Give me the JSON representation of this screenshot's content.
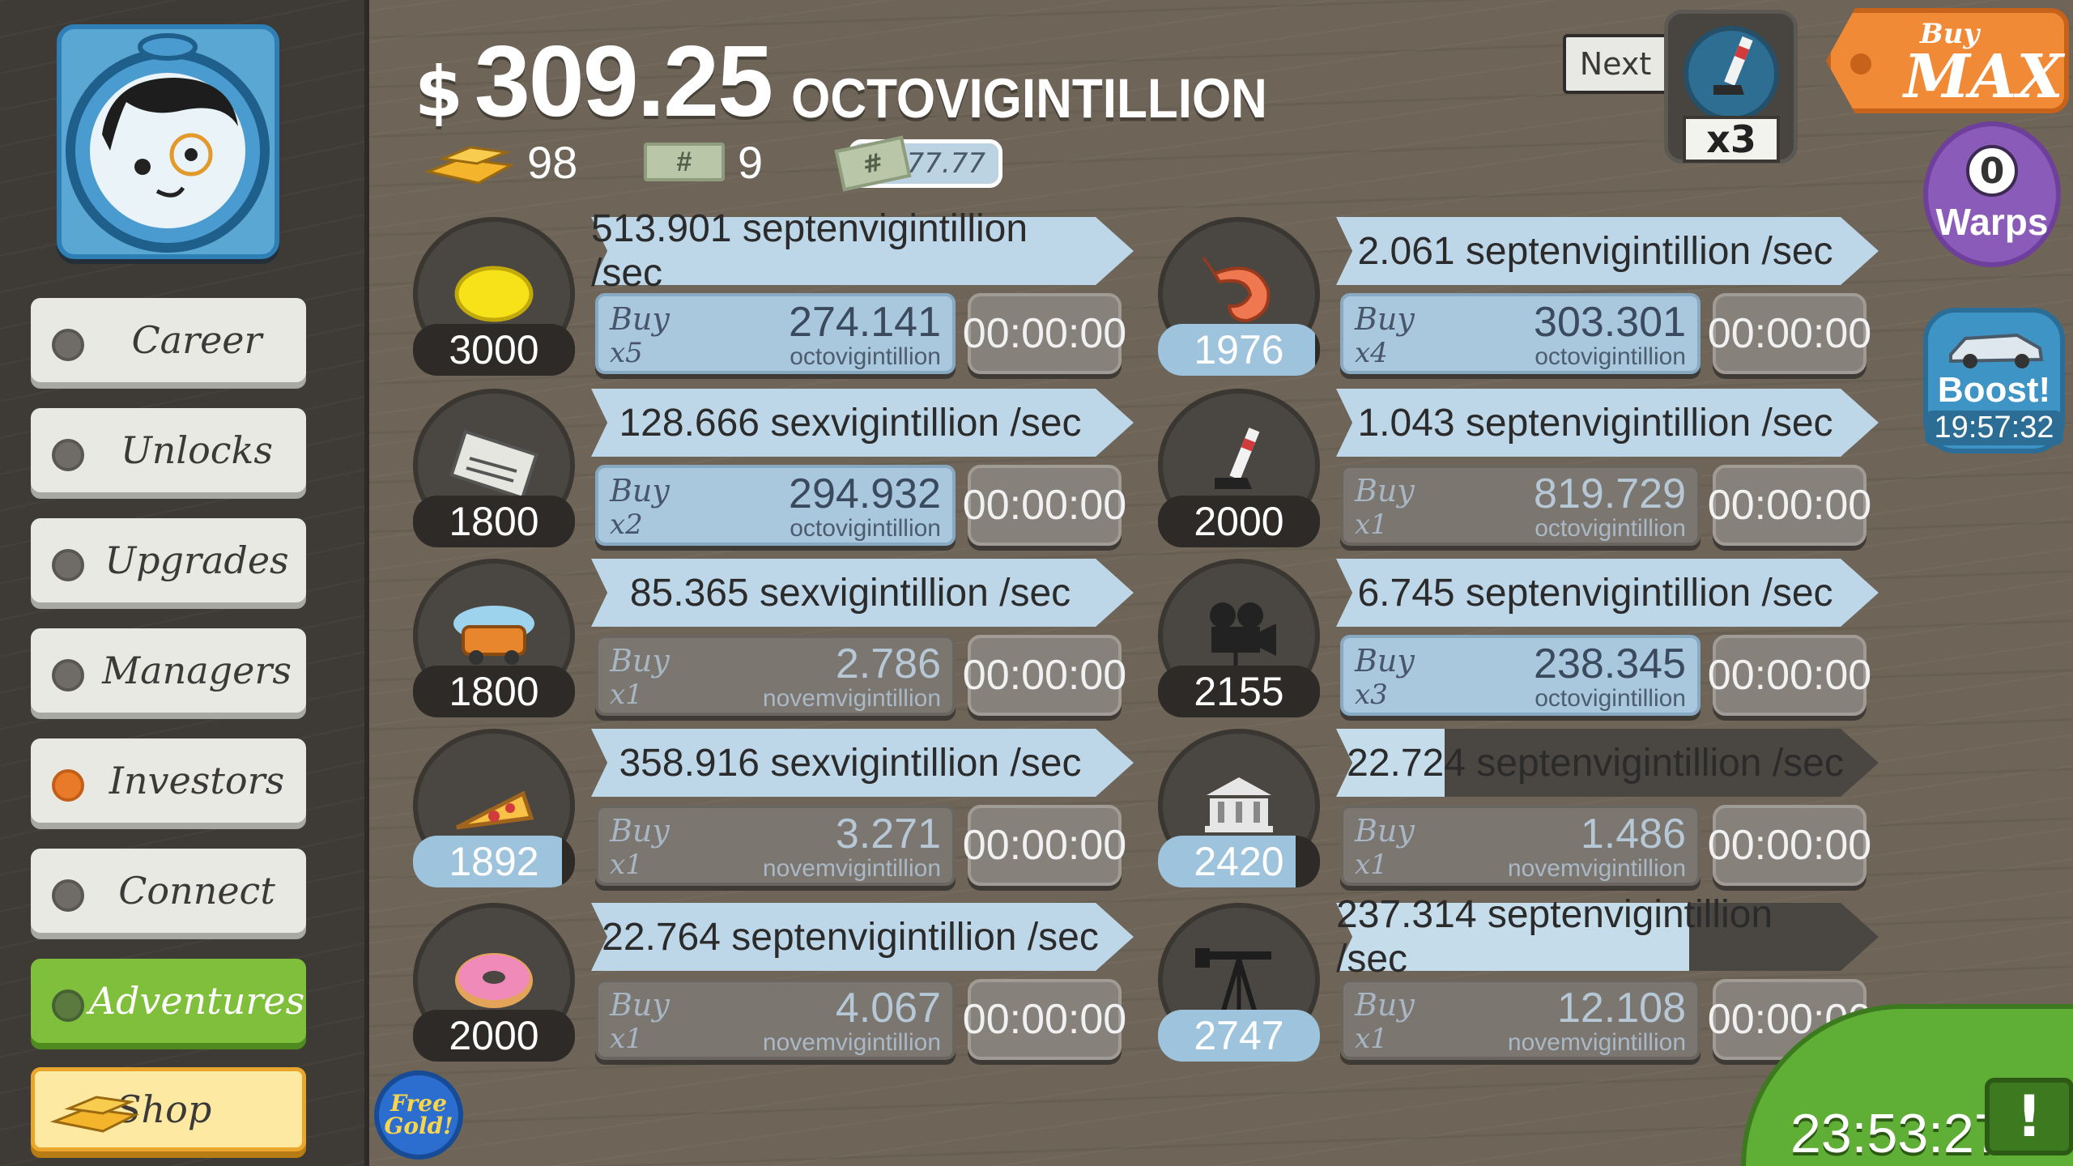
{
  "header": {
    "currency_symbol": "$",
    "money_amount": "309.25",
    "money_unit": "OCTOVIGINTILLION",
    "gold_count": "98",
    "bill_icon_label": "#",
    "bill_count": "9",
    "multiplier_text": "x777.77"
  },
  "nav": [
    {
      "label": "Career",
      "active": false
    },
    {
      "label": "Unlocks",
      "active": false
    },
    {
      "label": "Upgrades",
      "active": false
    },
    {
      "label": "Managers",
      "active": false
    },
    {
      "label": "Investors",
      "active": true
    },
    {
      "label": "Connect",
      "active": false
    },
    {
      "label": "Adventures",
      "active": false
    },
    {
      "label": "Shop",
      "active": false
    }
  ],
  "controls": {
    "next_label": "Next",
    "next_multiplier": "x3",
    "buy_label": "Buy",
    "max_label": "MAX",
    "warps_count": "0",
    "warps_label": "Warps",
    "boost_label": "Boost!",
    "boost_timer": "19:57:32",
    "free_gold_line1": "Free",
    "free_gold_line2": "Gold!",
    "tv_timer": "23:53:27",
    "tv_badge": "!"
  },
  "businesses": [
    {
      "icon": "lemon-icon",
      "level": "3000",
      "level_progress": 0,
      "rate": "513.901 septenvigintillion /sec",
      "rate_progress": 1,
      "buy_label": "Buy",
      "buy_mult": "x5",
      "cost": "274.141",
      "cost_unit": "octovigintillion",
      "affordable": true,
      "timer": "00:00:00"
    },
    {
      "icon": "newspaper-icon",
      "level": "1800",
      "level_progress": 0,
      "rate": "128.666 sexvigintillion /sec",
      "rate_progress": 1,
      "buy_label": "Buy",
      "buy_mult": "x2",
      "cost": "294.932",
      "cost_unit": "octovigintillion",
      "affordable": true,
      "timer": "00:00:00"
    },
    {
      "icon": "car-wash-icon",
      "level": "1800",
      "level_progress": 0,
      "rate": "85.365 sexvigintillion /sec",
      "rate_progress": 1,
      "buy_label": "Buy",
      "buy_mult": "x1",
      "cost": "2.786",
      "cost_unit": "novemvigintillion",
      "affordable": false,
      "timer": "00:00:00"
    },
    {
      "icon": "pizza-icon",
      "level": "1892",
      "level_progress": 0.92,
      "rate": "358.916 sexvigintillion /sec",
      "rate_progress": 1,
      "buy_label": "Buy",
      "buy_mult": "x1",
      "cost": "3.271",
      "cost_unit": "novemvigintillion",
      "affordable": false,
      "timer": "00:00:00"
    },
    {
      "icon": "donut-icon",
      "level": "2000",
      "level_progress": 0,
      "rate": "22.764 septenvigintillion /sec",
      "rate_progress": 1,
      "buy_label": "Buy",
      "buy_mult": "x1",
      "cost": "4.067",
      "cost_unit": "novemvigintillion",
      "affordable": false,
      "timer": "00:00:00"
    },
    {
      "icon": "shrimp-icon",
      "level": "1976",
      "level_progress": 0.97,
      "rate": "2.061 septenvigintillion /sec",
      "rate_progress": 1,
      "buy_label": "Buy",
      "buy_mult": "x4",
      "cost": "303.301",
      "cost_unit": "octovigintillion",
      "affordable": true,
      "timer": "00:00:00"
    },
    {
      "icon": "hockey-stick-icon",
      "level": "2000",
      "level_progress": 0,
      "rate": "1.043 septenvigintillion /sec",
      "rate_progress": 1,
      "buy_label": "Buy",
      "buy_mult": "x1",
      "cost": "819.729",
      "cost_unit": "octovigintillion",
      "affordable": false,
      "timer": "00:00:00"
    },
    {
      "icon": "movie-camera-icon",
      "level": "2155",
      "level_progress": 0,
      "rate": "6.745 septenvigintillion /sec",
      "rate_progress": 1,
      "buy_label": "Buy",
      "buy_mult": "x3",
      "cost": "238.345",
      "cost_unit": "octovigintillion",
      "affordable": true,
      "timer": "00:00:00"
    },
    {
      "icon": "bank-icon",
      "level": "2420",
      "level_progress": 0.85,
      "rate": "22.724 septenvigintillion /sec",
      "rate_progress": 0.2,
      "buy_label": "Buy",
      "buy_mult": "x1",
      "cost": "1.486",
      "cost_unit": "novemvigintillion",
      "affordable": false,
      "timer": "00:00:00"
    },
    {
      "icon": "oil-derrick-icon",
      "level": "2747",
      "level_progress": 1,
      "rate": "237.314 septenvigintillion /sec",
      "rate_progress": 0.65,
      "buy_label": "Buy",
      "buy_mult": "x1",
      "cost": "12.108",
      "cost_unit": "novemvigintillion",
      "affordable": false,
      "timer": "00:00:00"
    }
  ]
}
